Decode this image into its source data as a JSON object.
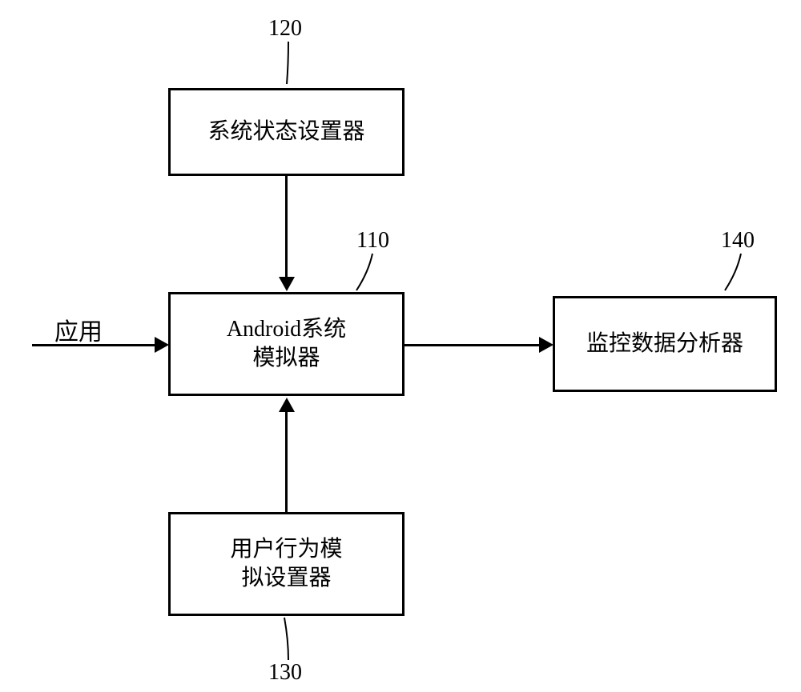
{
  "diagram": {
    "input_label": "应用",
    "boxes": {
      "system_state_setter": {
        "number": "120",
        "text": "系统状态设置器"
      },
      "android_emulator": {
        "number": "110",
        "text": "Android系统\n模拟器"
      },
      "user_behavior_setter": {
        "number": "130",
        "text": "用户行为模\n拟设置器"
      },
      "monitor_analyzer": {
        "number": "140",
        "text": "监控数据分析器"
      }
    }
  }
}
